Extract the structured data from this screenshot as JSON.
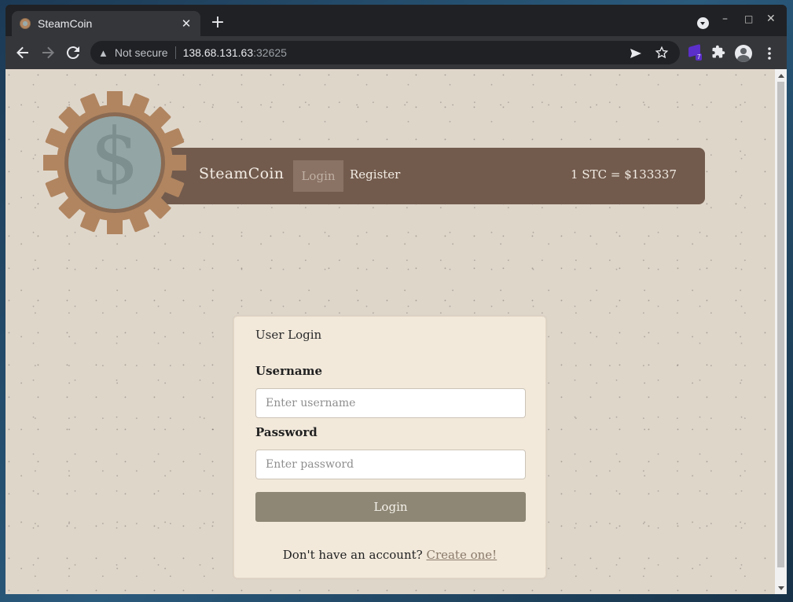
{
  "browser": {
    "tab_title": "SteamCoin",
    "tab_close": "✕",
    "new_tab": "+",
    "security_label": "Not secure",
    "url_host": "138.68.131.63",
    "url_port": ":32625",
    "extension_badge_count": "7"
  },
  "site": {
    "brand": "SteamCoin",
    "nav": {
      "login": "Login",
      "register": "Register"
    },
    "rate": "1 STC = $133337",
    "logo_symbol": "$"
  },
  "login_card": {
    "title": "User Login",
    "username_label": "Username",
    "username_placeholder": "Enter username",
    "password_label": "Password",
    "password_placeholder": "Enter password",
    "submit_label": "Login",
    "signup_prompt": "Don't have an account?",
    "signup_link": "Create one!"
  },
  "colors": {
    "page_background": "#dfd6ca",
    "navbar": "#725b4d",
    "active_nav": "#8a7264",
    "gear": "#b08560",
    "coin": "#93a5a5",
    "button": "#8e8775",
    "card": "#f2e9db"
  },
  "icons": {
    "back": "arrow-left-icon",
    "forward": "arrow-right-icon",
    "reload": "reload-icon",
    "warning": "warning-icon",
    "share": "send-icon",
    "bookmark": "star-icon",
    "extensions": "puzzle-icon",
    "profile": "avatar-icon",
    "menu": "kebab-menu-icon"
  }
}
